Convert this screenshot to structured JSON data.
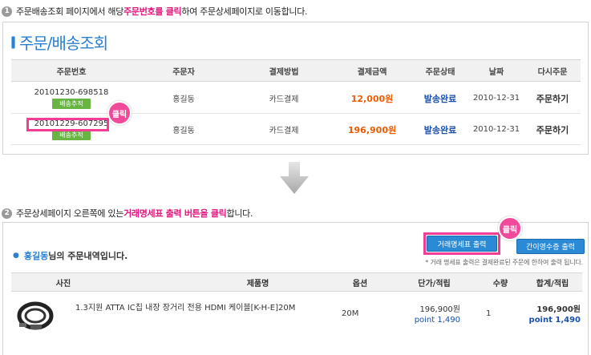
{
  "step1": {
    "num": "1",
    "pre": "주문배송조회 페이지에서 해당 ",
    "hl": "주문번호를 클릭",
    "post": "하여 주문상세페이지로 이동합니다."
  },
  "panel1": {
    "title": "주문/배송조회",
    "columns": [
      "주문번호",
      "주문자",
      "결제방법",
      "결제금액",
      "주문상태",
      "날짜",
      "다시주문"
    ],
    "rows": [
      {
        "order_no": "20101230-698518",
        "badge": "배송추적",
        "orderer": "홍길동",
        "payment": "카드결제",
        "amount": "12,000원",
        "status": "발송완료",
        "date": "2010-12-31",
        "reorder": "주문하기"
      },
      {
        "order_no": "20101229-607295",
        "badge": "배송추적",
        "orderer": "홍길동",
        "payment": "카드결제",
        "amount": "196,900원",
        "status": "발송완료",
        "date": "2010-12-31",
        "reorder": "주문하기"
      }
    ],
    "click_label": "클릭"
  },
  "step2": {
    "num": "2",
    "pre": "주문상세페이지 오른쪽에 있는 ",
    "hl": "거래명세표 출력 버튼을 클릭",
    "post": "합니다."
  },
  "panel2": {
    "user_name": "홍길동",
    "title_suffix": "님의 주문내역입니다.",
    "invoice_button": "거래명세표 출력",
    "receipt_button": "간이영수증 출력",
    "click_label": "클릭",
    "note": "* 거래 명세표 출력은 결제완료된 주문에 한하여 출력 됩니다.",
    "columns": [
      "사진",
      "제품명",
      "옵션",
      "단가/적립",
      "수량",
      "합계/적립"
    ],
    "item": {
      "name": "1.3지원 ATTA IC칩 내장 장거리 전용 HDMI 케이블[K-H-E]20M",
      "option": "20M",
      "unit_price": "196,900원",
      "unit_point": "point 1,490",
      "qty": "1",
      "total_price": "196,900원",
      "total_point": "point 1,490"
    }
  },
  "colors": {
    "accent_blue": "#2a7fd1",
    "highlight_pink": "#e2167e",
    "amount_orange": "#ee5a00",
    "status_blue": "#1a4fae",
    "badge_green": "#68b544"
  }
}
